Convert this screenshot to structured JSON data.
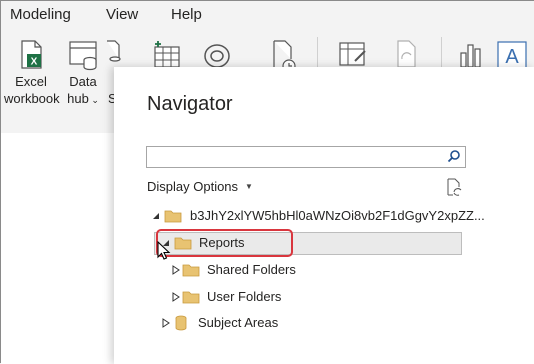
{
  "menu": {
    "items": [
      "Modeling",
      "View",
      "Help"
    ]
  },
  "ribbon": {
    "buttons": [
      {
        "label_line1": "Excel",
        "label_line2": "workbook",
        "icon": "excel-workbook-icon"
      },
      {
        "label_line1": "Data",
        "label_line2": "hub",
        "icon": "data-hub-icon"
      },
      {
        "label_line2": "S",
        "icon": "sql-server-icon"
      }
    ]
  },
  "navigator": {
    "title": "Navigator",
    "search": {
      "value": "",
      "placeholder": ""
    },
    "display_options_label": "Display Options",
    "tree": {
      "root_label": "b3JhY2xlYW5hbHl0aWNzOi8vb2F1dGgvY2xpZZ...",
      "items": [
        {
          "label": "Reports",
          "selected": true
        },
        {
          "label": "Shared Folders"
        },
        {
          "label": "User Folders"
        },
        {
          "label": "Subject Areas"
        }
      ]
    }
  },
  "colors": {
    "highlight": "#d9363e",
    "folder": "#e8c372",
    "excel": "#1e7145"
  }
}
